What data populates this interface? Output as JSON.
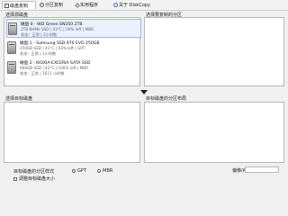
{
  "tabs": [
    {
      "label": "磁盘复制",
      "icon": "copy-icon"
    },
    {
      "label": "分区复制",
      "icon": "gear-icon"
    },
    {
      "label": "实用程序",
      "icon": "wrench-icon"
    },
    {
      "label": "关于 DiskCopy",
      "icon": "info-icon"
    }
  ],
  "source": {
    "title": "选择源磁盘",
    "disks": [
      {
        "line1": "磁盘 0 - WD Green SN350 2TB",
        "line2": "2TB NVMe SSD | 43°C | 54% left | MBR",
        "line3": "状态：正常 | 1小时数"
      },
      {
        "line1": "磁盘 1 - Samsung SSD 970 EVO 250GB",
        "line2": "250GB SSD | 41°C | 93% left | GPT",
        "line3": "状态：正常 | 1小时数"
      },
      {
        "line1": "磁盘 2 - KIOXIA-EXCERIA SATA SSD",
        "line2": "960GB SSD | 42°C | 100% left | MBR",
        "line3": "状态：正常 | 1611 小时数"
      }
    ]
  },
  "source_partitions": {
    "title": "选择要复制的分区"
  },
  "target": {
    "title": "选择目标磁盘"
  },
  "target_layout": {
    "title": "目标磁盘的分区布局"
  },
  "options": {
    "partition_format_label": "目标磁盘的分区样式",
    "gpt": "GPT",
    "mbr": "MBR",
    "checkbox_label": "调整目标磁盘大小",
    "offset_label": "偏移(MB):"
  }
}
